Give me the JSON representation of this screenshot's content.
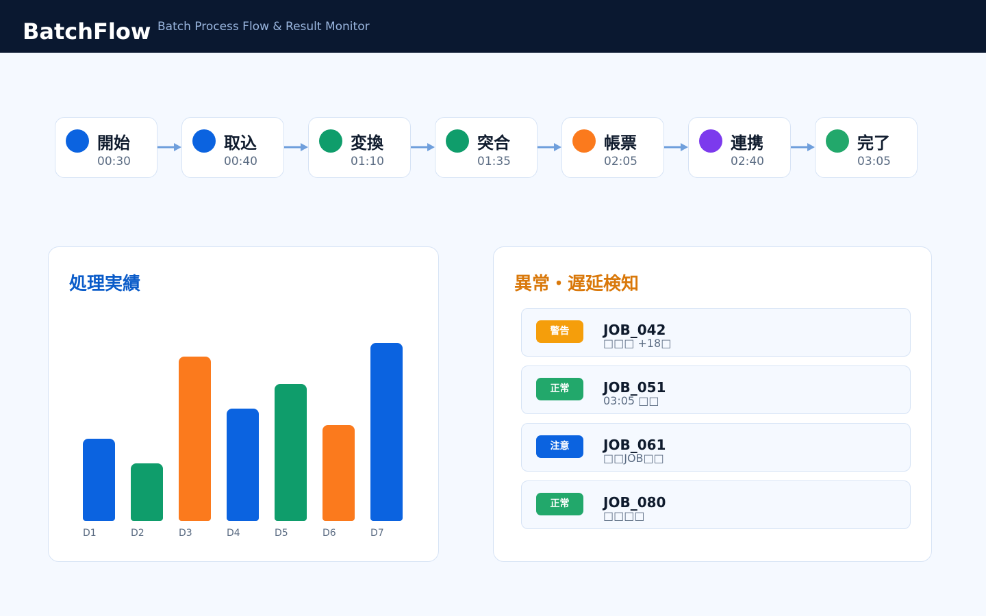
{
  "header": {
    "brand": "BatchFlow",
    "tagline": "Batch Process Flow & Result Monitor"
  },
  "flow": {
    "steps": [
      {
        "name": "開始",
        "time": "00:30",
        "color": "#0b63e0"
      },
      {
        "name": "取込",
        "time": "00:40",
        "color": "#0b63e0"
      },
      {
        "name": "変換",
        "time": "01:10",
        "color": "#0f9d6b"
      },
      {
        "name": "突合",
        "time": "01:35",
        "color": "#0f9d6b"
      },
      {
        "name": "帳票",
        "time": "02:05",
        "color": "#fb7a1d"
      },
      {
        "name": "連携",
        "time": "02:40",
        "color": "#7c3aed"
      },
      {
        "name": "完了",
        "time": "03:05",
        "color": "#22a86b"
      }
    ],
    "arrow_color": "#6f9fdc"
  },
  "results_panel": {
    "title": "処理実績",
    "chart_data": {
      "type": "bar",
      "title": "処理実績",
      "categories": [
        "D1",
        "D2",
        "D3",
        "D4",
        "D5",
        "D6",
        "D7"
      ],
      "values": [
        120,
        84,
        240,
        164,
        200,
        140,
        260
      ],
      "colors": [
        "#0b63e0",
        "#0f9d6b",
        "#fb7a1d",
        "#0b63e0",
        "#0f9d6b",
        "#fb7a1d",
        "#0b63e0"
      ],
      "ylim": [
        0,
        260
      ],
      "grid": false,
      "xlabel": "",
      "ylabel": ""
    }
  },
  "alerts_panel": {
    "title": "異常・遅延検知",
    "items": [
      {
        "badge": "警告",
        "badge_color": "#f59e0b",
        "job": "JOB_042",
        "detail": "□□□ +18□"
      },
      {
        "badge": "正常",
        "badge_color": "#22a86b",
        "job": "JOB_051",
        "detail": "03:05 □□"
      },
      {
        "badge": "注意",
        "badge_color": "#0b63e0",
        "job": "JOB_061",
        "detail": "□□JOB□□"
      },
      {
        "badge": "正常",
        "badge_color": "#22a86b",
        "job": "JOB_080",
        "detail": "□□□□"
      }
    ]
  }
}
